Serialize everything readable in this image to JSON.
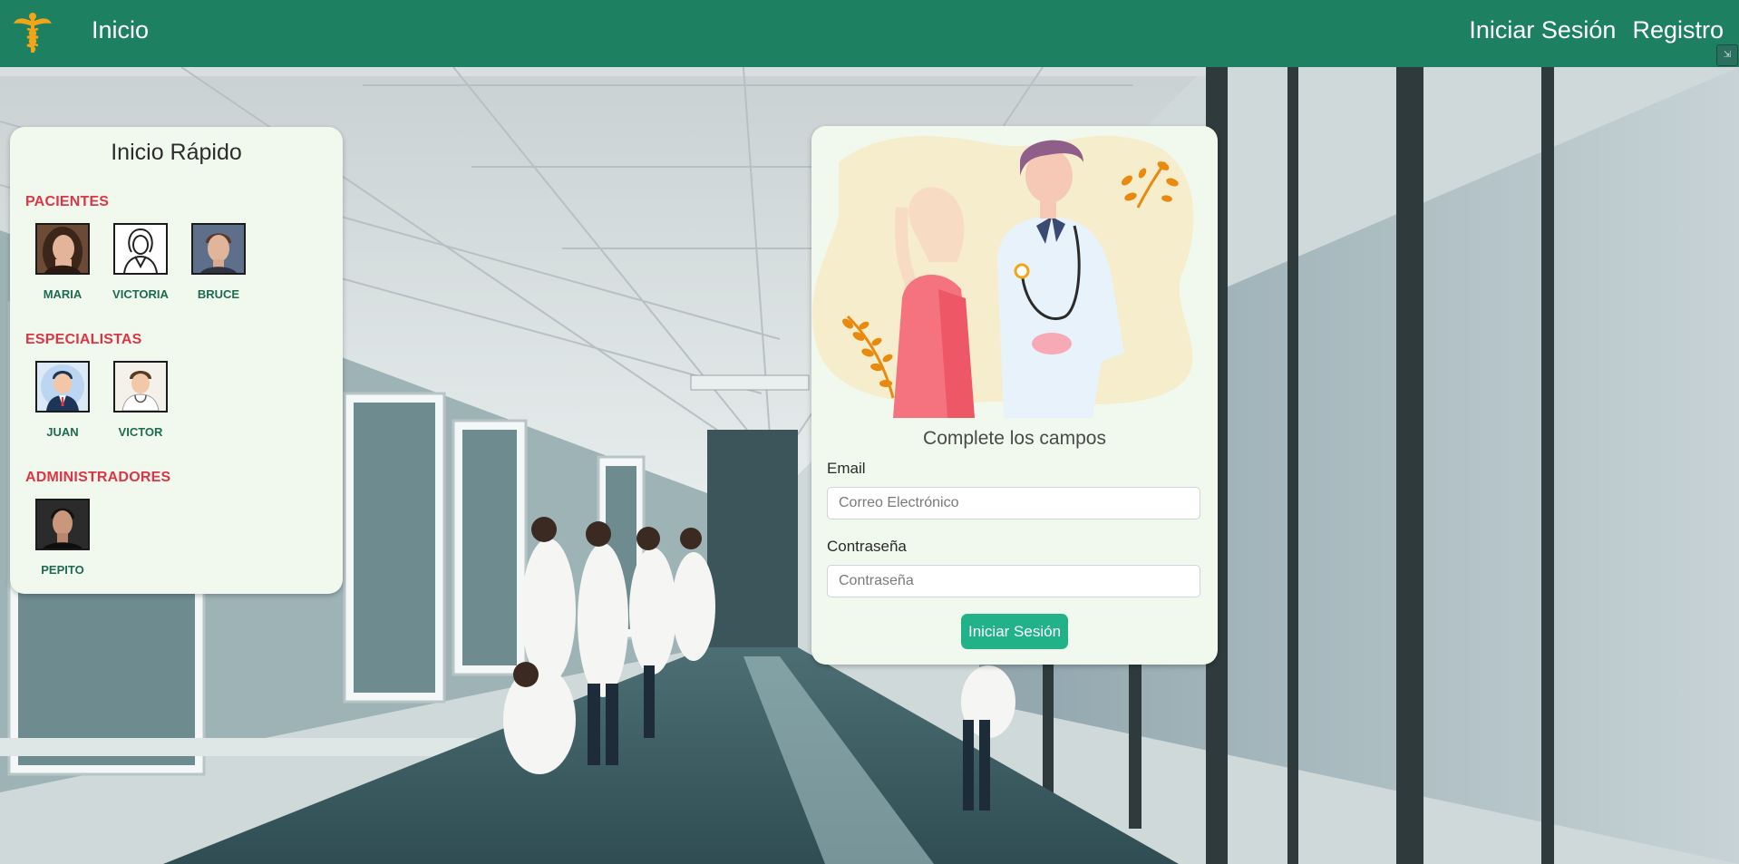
{
  "navbar": {
    "home_label": "Inicio",
    "login_label": "Iniciar Sesión",
    "register_label": "Registro",
    "logo_icon": "caduceus-icon"
  },
  "quick_login": {
    "title": "Inicio Rápido",
    "groups": [
      {
        "title": "PACIENTES",
        "users": [
          {
            "name": "MARIA",
            "avatar": "female-photo-avatar"
          },
          {
            "name": "VICTORIA",
            "avatar": "female-outline-avatar"
          },
          {
            "name": "BRUCE",
            "avatar": "male-photo-avatar"
          }
        ]
      },
      {
        "title": "ESPECIALISTAS",
        "users": [
          {
            "name": "JUAN",
            "avatar": "male-cartoon-avatar"
          },
          {
            "name": "VICTOR",
            "avatar": "doctor-cartoon-avatar"
          }
        ]
      },
      {
        "title": "ADMINISTRADORES",
        "users": [
          {
            "name": "PEPITO",
            "avatar": "male-photo-avatar"
          }
        ]
      }
    ]
  },
  "login_form": {
    "heading": "Complete los campos",
    "email_label": "Email",
    "email_placeholder": "Correo Electrónico",
    "password_label": "Contraseña",
    "password_placeholder": "Contraseña",
    "submit_label": "Iniciar Sesión"
  },
  "colors": {
    "navbar": "#1d8061",
    "panel": "#f1f9ee",
    "group_title": "#dc3545",
    "user_name": "#1d6b50",
    "button": "#21b287"
  }
}
